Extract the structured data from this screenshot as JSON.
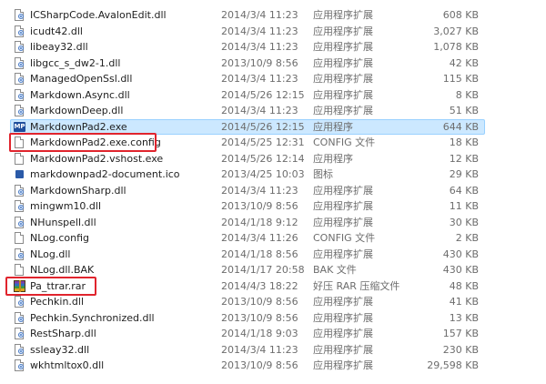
{
  "files": [
    {
      "name": "ICSharpCode.AvalonEdit.dll",
      "date": "2014/3/4 11:23",
      "type": "应用程序扩展",
      "size": "608 KB",
      "icon": "dll-icon"
    },
    {
      "name": "icudt42.dll",
      "date": "2014/3/4 11:23",
      "type": "应用程序扩展",
      "size": "3,027 KB",
      "icon": "dll-icon"
    },
    {
      "name": "libeay32.dll",
      "date": "2014/3/4 11:23",
      "type": "应用程序扩展",
      "size": "1,078 KB",
      "icon": "dll-icon"
    },
    {
      "name": "libgcc_s_dw2-1.dll",
      "date": "2013/10/9 8:56",
      "type": "应用程序扩展",
      "size": "42 KB",
      "icon": "dll-icon"
    },
    {
      "name": "ManagedOpenSsl.dll",
      "date": "2014/3/4 11:23",
      "type": "应用程序扩展",
      "size": "115 KB",
      "icon": "dll-icon"
    },
    {
      "name": "Markdown.Async.dll",
      "date": "2014/5/26 12:15",
      "type": "应用程序扩展",
      "size": "8 KB",
      "icon": "dll-icon"
    },
    {
      "name": "MarkdownDeep.dll",
      "date": "2014/3/4 11:23",
      "type": "应用程序扩展",
      "size": "51 KB",
      "icon": "dll-icon"
    },
    {
      "name": "MarkdownPad2.exe",
      "date": "2014/5/26 12:15",
      "type": "应用程序",
      "size": "644 KB",
      "icon": "exe-icon",
      "selected": true,
      "icon_text": "MP"
    },
    {
      "name": "MarkdownPad2.exe.config",
      "date": "2014/5/25 12:31",
      "type": "CONFIG 文件",
      "size": "18 KB",
      "icon": "file-icon",
      "highlighted": true
    },
    {
      "name": "MarkdownPad2.vshost.exe",
      "date": "2014/5/26 12:14",
      "type": "应用程序",
      "size": "12 KB",
      "icon": "file-icon"
    },
    {
      "name": "markdownpad2-document.ico",
      "date": "2013/4/25 10:03",
      "type": "图标",
      "size": "29 KB",
      "icon": "ico-icon"
    },
    {
      "name": "MarkdownSharp.dll",
      "date": "2014/3/4 11:23",
      "type": "应用程序扩展",
      "size": "64 KB",
      "icon": "dll-icon"
    },
    {
      "name": "mingwm10.dll",
      "date": "2013/10/9 8:56",
      "type": "应用程序扩展",
      "size": "11 KB",
      "icon": "dll-icon"
    },
    {
      "name": "NHunspell.dll",
      "date": "2014/1/18 9:12",
      "type": "应用程序扩展",
      "size": "30 KB",
      "icon": "dll-icon"
    },
    {
      "name": "NLog.config",
      "date": "2014/3/4 11:26",
      "type": "CONFIG 文件",
      "size": "2 KB",
      "icon": "file-icon"
    },
    {
      "name": "NLog.dll",
      "date": "2014/1/18 8:56",
      "type": "应用程序扩展",
      "size": "430 KB",
      "icon": "dll-icon"
    },
    {
      "name": "NLog.dll.BAK",
      "date": "2014/1/17 20:58",
      "type": "BAK 文件",
      "size": "430 KB",
      "icon": "file-icon"
    },
    {
      "name": "Pa_ttrar.rar",
      "date": "2014/4/3 18:22",
      "type": "好压 RAR 压缩文件",
      "size": "48 KB",
      "icon": "rar-icon",
      "highlighted": true
    },
    {
      "name": "Pechkin.dll",
      "date": "2013/10/9 8:56",
      "type": "应用程序扩展",
      "size": "41 KB",
      "icon": "dll-icon"
    },
    {
      "name": "Pechkin.Synchronized.dll",
      "date": "2013/10/9 8:56",
      "type": "应用程序扩展",
      "size": "13 KB",
      "icon": "dll-icon"
    },
    {
      "name": "RestSharp.dll",
      "date": "2014/1/18 9:03",
      "type": "应用程序扩展",
      "size": "157 KB",
      "icon": "dll-icon"
    },
    {
      "name": "ssleay32.dll",
      "date": "2014/3/4 11:23",
      "type": "应用程序扩展",
      "size": "230 KB",
      "icon": "dll-icon"
    },
    {
      "name": "wkhtmltox0.dll",
      "date": "2013/10/9 8:56",
      "type": "应用程序扩展",
      "size": "29,598 KB",
      "icon": "dll-icon"
    }
  ],
  "colors": {
    "selection_fill": "#cce8ff",
    "selection_border": "#99d1ff",
    "annotation_red": "#e0242d"
  }
}
